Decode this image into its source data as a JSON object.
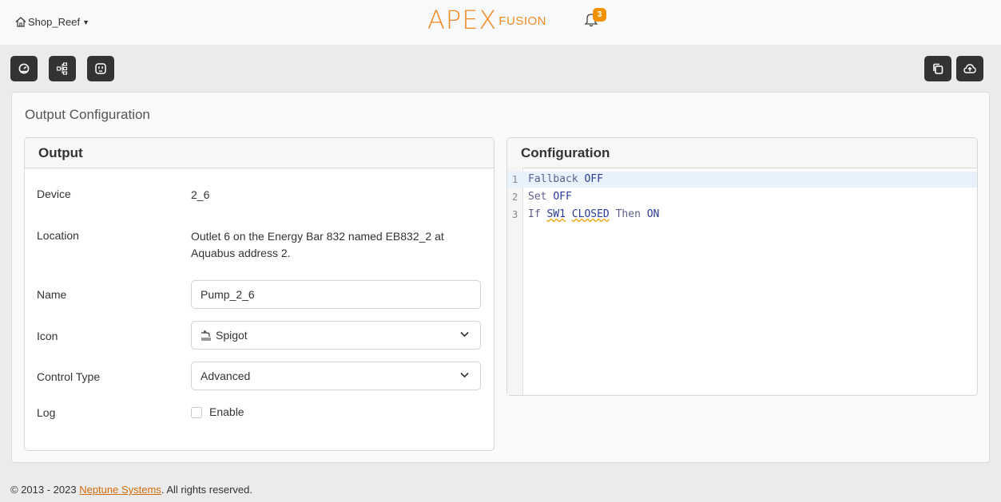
{
  "topbar": {
    "site_name": "Shop_Reef",
    "logo_apex": "APEX",
    "logo_fusion": "FUSION",
    "notifications_count": "3"
  },
  "toolbar": {
    "left_icons": [
      "dashboard-gauge-icon",
      "device-tree-icon",
      "outlet-icon"
    ],
    "right_icons": [
      "copy-icon",
      "cloud-upload-icon"
    ]
  },
  "page": {
    "title": "Output Configuration"
  },
  "output_panel": {
    "heading": "Output",
    "device_label": "Device",
    "device_value": "2_6",
    "location_label": "Location",
    "location_value_line1": "Outlet 6 on the Energy Bar 832 named EB832_2 at",
    "location_value_line2": "Aquabus address 2.",
    "name_label": "Name",
    "name_value": "Pump_2_6",
    "icon_label": "Icon",
    "icon_value": "Spigot",
    "icon_glyph": "spigot-icon",
    "control_type_label": "Control Type",
    "control_type_value": "Advanced",
    "log_label": "Log",
    "log_checkbox_label": "Enable",
    "log_enabled": false
  },
  "config_panel": {
    "heading": "Configuration",
    "lines": [
      {
        "num": "1",
        "tokens": [
          [
            "Fallback",
            "ident"
          ],
          [
            " ",
            "sp"
          ],
          [
            "OFF",
            "kw"
          ]
        ]
      },
      {
        "num": "2",
        "tokens": [
          [
            "Set",
            "ident"
          ],
          [
            " ",
            "sp"
          ],
          [
            "OFF",
            "kw"
          ]
        ]
      },
      {
        "num": "3",
        "tokens": [
          [
            "If",
            "ident"
          ],
          [
            " ",
            "sp"
          ],
          [
            "SW1",
            "kw"
          ],
          [
            " ",
            "sp"
          ],
          [
            "CLOSED",
            "kw"
          ],
          [
            " ",
            "sp"
          ],
          [
            "Then",
            "ident"
          ],
          [
            " ",
            "sp"
          ],
          [
            "ON",
            "kw"
          ]
        ]
      }
    ]
  },
  "footer": {
    "prefix": "© 2013 - 2023 ",
    "link": "Neptune Systems",
    "suffix": ". All rights reserved."
  },
  "colors": {
    "accent": "#f08a24",
    "badge": "#f39200",
    "toolbar_button": "#333333",
    "link": "#d46b08"
  }
}
